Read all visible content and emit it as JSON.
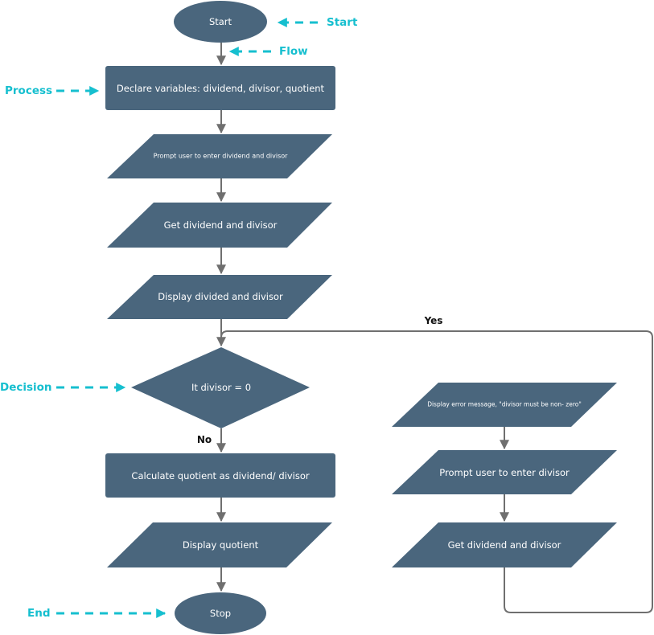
{
  "colors": {
    "node_fill": "#4a667d",
    "node_text": "#ffffff",
    "connector": "#6f6f6f",
    "annotation": "#16bfcf",
    "branch_label": "#111111"
  },
  "nodes": {
    "start": {
      "type": "terminator",
      "label": "Start"
    },
    "declare": {
      "type": "process",
      "label": "Declare variables: dividend, divisor, quotient"
    },
    "prompt_both": {
      "type": "input-output",
      "label": "Prompt user to enter dividend and divisor"
    },
    "get_both": {
      "type": "input-output",
      "label": "Get dividend and divisor"
    },
    "display_both": {
      "type": "input-output",
      "label": "Display divided and divisor"
    },
    "decision": {
      "type": "decision",
      "label": "It divisor = 0"
    },
    "calculate": {
      "type": "process",
      "label": "Calculate quotient as dividend/ divisor"
    },
    "display_quotient": {
      "type": "input-output",
      "label": "Display quotient"
    },
    "stop": {
      "type": "terminator",
      "label": "Stop"
    },
    "error_message": {
      "type": "input-output",
      "label": "Display error message, \"divisor must be non- zero\""
    },
    "prompt_divisor": {
      "type": "input-output",
      "label": "Prompt user to enter divisor"
    },
    "get_again": {
      "type": "input-output",
      "label": "Get dividend and divisor"
    }
  },
  "branch_labels": {
    "yes": "Yes",
    "no": "No"
  },
  "annotations": {
    "start": "Start",
    "flow": "Flow",
    "process": "Process",
    "decision": "Decision",
    "end": "End"
  },
  "edges": [
    {
      "from": "start",
      "to": "declare"
    },
    {
      "from": "declare",
      "to": "prompt_both"
    },
    {
      "from": "prompt_both",
      "to": "get_both"
    },
    {
      "from": "get_both",
      "to": "display_both"
    },
    {
      "from": "display_both",
      "to": "decision"
    },
    {
      "from": "decision",
      "to": "calculate",
      "label": "No"
    },
    {
      "from": "decision",
      "to": "error_message",
      "label": "Yes"
    },
    {
      "from": "calculate",
      "to": "display_quotient"
    },
    {
      "from": "display_quotient",
      "to": "stop"
    },
    {
      "from": "error_message",
      "to": "prompt_divisor"
    },
    {
      "from": "prompt_divisor",
      "to": "get_again"
    },
    {
      "from": "get_again",
      "to": "decision"
    }
  ]
}
